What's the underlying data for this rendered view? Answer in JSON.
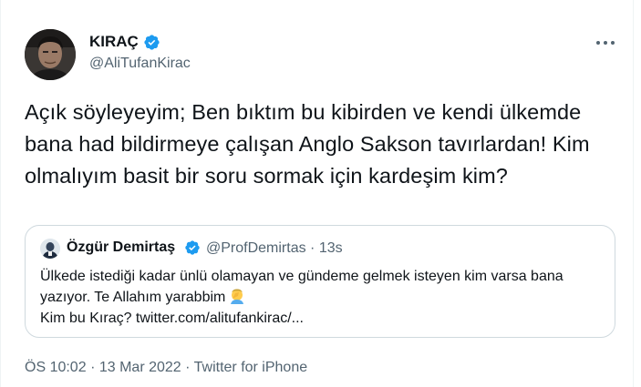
{
  "author": {
    "name": "KIRAÇ",
    "handle": "@AliTufanKirac",
    "avatar_icon": "profile-photo",
    "verified_color": "#1d9bf0"
  },
  "tweet": {
    "text": "Açık söyleyeyim; Ben bıktım bu kibirden ve kendi ülkemde bana had bildirmeye çalışan Anglo Sakson tavırlardan! Kim olmalıyım basit bir soru sormak için kardeşim kim?"
  },
  "quoted_tweet": {
    "name": "Özgür Demirtaş",
    "handle": "@ProfDemirtas",
    "separator": "·",
    "age": "13s",
    "text_line1": "Ülkede istediği kadar ünlü olamayan ve gündeme gelmek isteyen kim varsa bana",
    "text_line2": "yazıyor. Te Allahım yarabbim",
    "emoji_icon": "facepalm-emoji",
    "text_line3": "Kim bu Kıraç? twitter.com/alitufankirac/..."
  },
  "meta": {
    "time": "ÖS 10:02",
    "sep1": "·",
    "date": "13 Mar 2022",
    "sep2": "·",
    "source": "Twitter for iPhone"
  },
  "colors": {
    "text": "#0f1419",
    "secondary": "#536471",
    "border": "#cfd9de",
    "verified": "#1d9bf0"
  }
}
